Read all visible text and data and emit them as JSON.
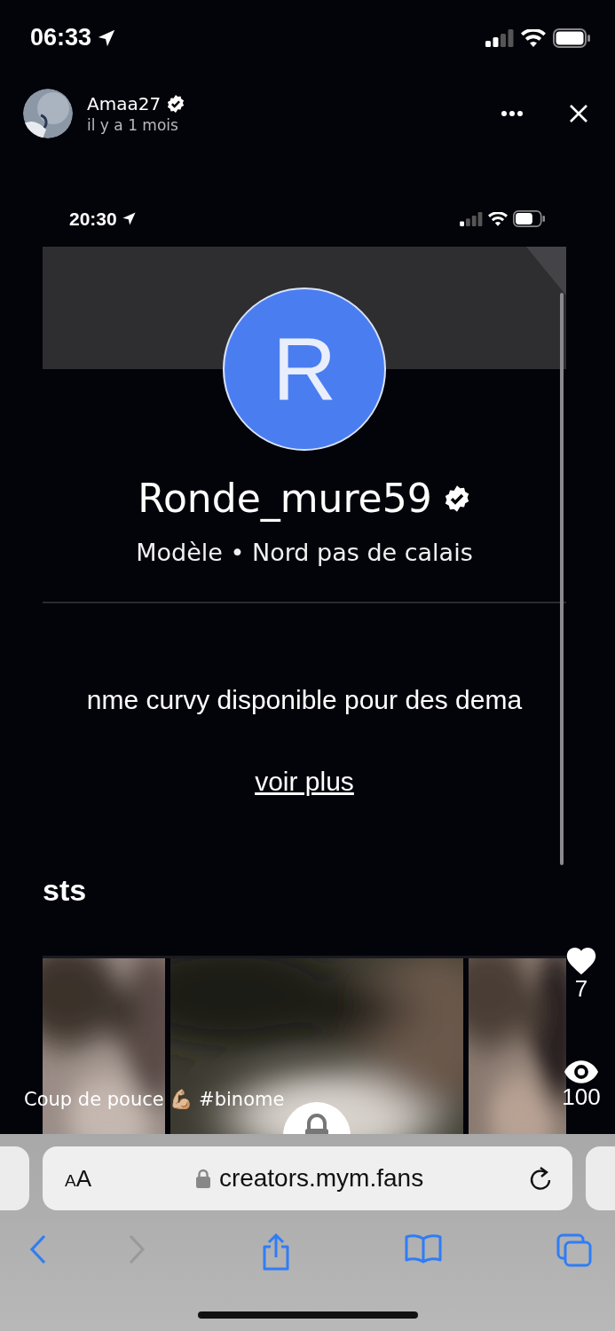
{
  "status_bar": {
    "time": "06:33"
  },
  "story": {
    "username": "Amaa27",
    "verified": true,
    "time_ago": "il y a 1 mois"
  },
  "embedded": {
    "status_time": "20:30",
    "avatar_letter": "R",
    "name": "Ronde_mure59",
    "verified": true,
    "subtitle": "Modèle • Nord pas de calais",
    "bio": "nme curvy disponible pour des dema",
    "more_link": "voir plus",
    "section_title": "sts",
    "pictures": [
      {
        "locked": false
      },
      {
        "locked": true
      },
      {
        "locked": false
      }
    ]
  },
  "caption": "Coup de pouce 💪🏼 #binome",
  "stats": [
    {
      "kind": "likes",
      "count": "7"
    },
    {
      "kind": "views",
      "count": "100"
    }
  ],
  "browser": {
    "text_size": "AA",
    "url": "creators.mym.fans",
    "back_disabled": false,
    "forward_disabled": true
  }
}
